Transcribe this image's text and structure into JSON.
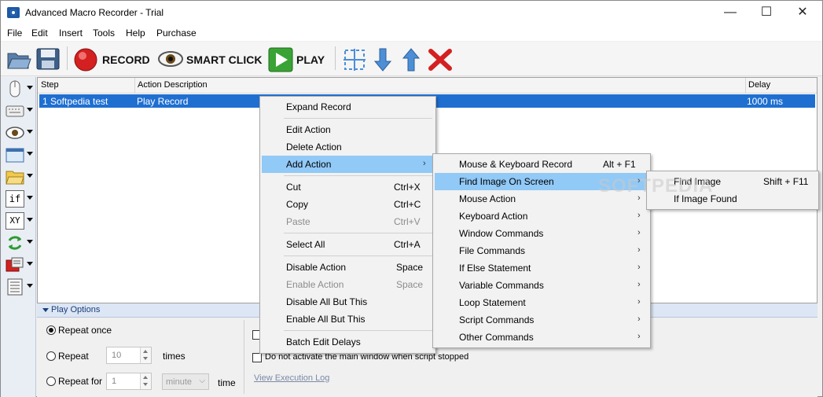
{
  "window": {
    "title": "Advanced Macro Recorder - Trial",
    "minimize_glyph": "—",
    "maximize_glyph": "☐",
    "close_glyph": "✕"
  },
  "menubar": [
    "File",
    "Edit",
    "Insert",
    "Tools",
    "Help",
    "Purchase"
  ],
  "toolbar": {
    "record_label": "RECORD",
    "smart_click_label": "SMART CLICK",
    "play_label": "PLAY"
  },
  "sidebar": {
    "if_label": "if",
    "xy_label": "XY"
  },
  "grid": {
    "columns": [
      "Step",
      "Action Description",
      "Delay"
    ],
    "rows": [
      {
        "step": "1  Softpedia test",
        "action": "Play Record",
        "delay": "1000 ms"
      }
    ]
  },
  "play_options": {
    "header": "Play Options",
    "repeat_once": "Repeat once",
    "repeat": "Repeat",
    "repeat_value": "10",
    "times": "times",
    "repeat_for": "Repeat for",
    "repeat_for_value": "1",
    "unit": "minute",
    "time": "time",
    "dont_activate": "Do not activate the main window when script stopped",
    "view_log": "View Execution Log"
  },
  "context_menu": {
    "items": [
      {
        "label": "Expand Record",
        "shortcut": ""
      },
      {
        "label": "Edit Action",
        "shortcut": ""
      },
      {
        "label": "Delete Action",
        "shortcut": ""
      },
      {
        "label": "Add Action",
        "shortcut": ""
      },
      {
        "label": "Cut",
        "shortcut": "Ctrl+X"
      },
      {
        "label": "Copy",
        "shortcut": "Ctrl+C"
      },
      {
        "label": "Paste",
        "shortcut": "Ctrl+V"
      },
      {
        "label": "Select All",
        "shortcut": "Ctrl+A"
      },
      {
        "label": "Disable Action",
        "shortcut": "Space"
      },
      {
        "label": "Enable Action",
        "shortcut": "Space"
      },
      {
        "label": "Disable All But This",
        "shortcut": ""
      },
      {
        "label": "Enable All But This",
        "shortcut": ""
      },
      {
        "label": "Batch Edit Delays",
        "shortcut": ""
      }
    ]
  },
  "add_action_menu": {
    "items": [
      {
        "label": "Mouse & Keyboard Record",
        "shortcut": "Alt + F1"
      },
      {
        "label": "Find Image On Screen",
        "shortcut": ""
      },
      {
        "label": "Mouse Action",
        "shortcut": ""
      },
      {
        "label": "Keyboard Action",
        "shortcut": ""
      },
      {
        "label": "Window Commands",
        "shortcut": ""
      },
      {
        "label": "File Commands",
        "shortcut": ""
      },
      {
        "label": "If Else Statement",
        "shortcut": ""
      },
      {
        "label": "Variable Commands",
        "shortcut": ""
      },
      {
        "label": "Loop Statement",
        "shortcut": ""
      },
      {
        "label": "Script Commands",
        "shortcut": ""
      },
      {
        "label": "Other Commands",
        "shortcut": ""
      }
    ]
  },
  "find_image_menu": {
    "items": [
      {
        "label": "Find Image",
        "shortcut": "Shift + F11"
      },
      {
        "label": "If Image Found",
        "shortcut": ""
      }
    ]
  },
  "watermark": "SOFTPEDIA",
  "submenu_glyph": "›",
  "colors": {
    "selection": "#1f6fd1",
    "menu_highlight": "#91c9f7",
    "record_red": "#d42020",
    "play_green": "#3aa335",
    "arrow_blue": "#4d8fd6"
  }
}
